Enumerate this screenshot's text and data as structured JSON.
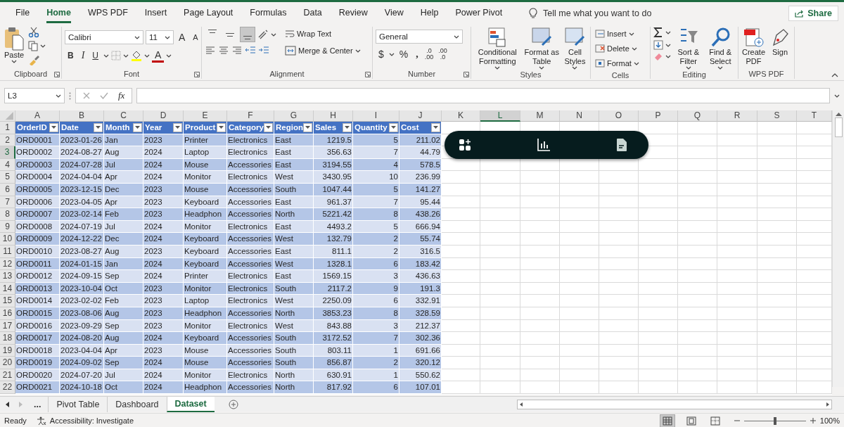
{
  "menu_tabs": [
    {
      "label": "File",
      "selected": false
    },
    {
      "label": "Home",
      "selected": true
    },
    {
      "label": "WPS PDF",
      "selected": false
    },
    {
      "label": "Insert",
      "selected": false
    },
    {
      "label": "Page Layout",
      "selected": false
    },
    {
      "label": "Formulas",
      "selected": false
    },
    {
      "label": "Data",
      "selected": false
    },
    {
      "label": "Review",
      "selected": false
    },
    {
      "label": "View",
      "selected": false
    },
    {
      "label": "Help",
      "selected": false
    },
    {
      "label": "Power Pivot",
      "selected": false
    }
  ],
  "tell_me": {
    "placeholder": "Tell me what you want to do"
  },
  "share_button": "Share",
  "ribbon": {
    "clipboard": {
      "paste": "Paste",
      "label": "Clipboard"
    },
    "font": {
      "font_name": "Calibri",
      "font_size": "11",
      "grow": "A",
      "shrink": "A",
      "bold": "B",
      "italic": "I",
      "underline": "U",
      "font_color": "A",
      "label": "Font"
    },
    "alignment": {
      "vertical_buttons": [
        {
          "selected": false
        },
        {
          "selected": false
        },
        {
          "selected": true
        }
      ],
      "wrap_text": "Wrap Text",
      "merge_center": "Merge & Center",
      "label": "Alignment"
    },
    "number": {
      "format": "General",
      "currency": "$",
      "percent": "%",
      "comma": ",",
      "increase_decimal": [
        ".0",
        ".00"
      ],
      "decrease_decimal": [
        ".00",
        ".0"
      ],
      "label": "Number"
    },
    "styles": {
      "buttons": [
        "Conditional Formatting",
        "Format as Table",
        "Cell Styles"
      ],
      "label": "Styles"
    },
    "cells": {
      "buttons": [
        "Insert",
        "Delete",
        "Format"
      ],
      "label": "Cells"
    },
    "editing": {
      "buttons": [
        "Sort & Filter",
        "Find & Select"
      ],
      "label": "Editing"
    },
    "wps_pdf": {
      "buttons": [
        "Create PDF",
        "Sign"
      ],
      "label": "WPS PDF"
    }
  },
  "formula_bar": {
    "name_box": "L3",
    "function_label": "fx"
  },
  "sheet": {
    "columns": [
      {
        "label": "A",
        "selected": false
      },
      {
        "label": "B",
        "selected": false
      },
      {
        "label": "C",
        "selected": false
      },
      {
        "label": "D",
        "selected": false
      },
      {
        "label": "E",
        "selected": false
      },
      {
        "label": "F",
        "selected": false
      },
      {
        "label": "G",
        "selected": false
      },
      {
        "label": "H",
        "selected": false
      },
      {
        "label": "I",
        "selected": false
      },
      {
        "label": "J",
        "selected": false
      },
      {
        "label": "K",
        "selected": false
      },
      {
        "label": "L",
        "selected": true
      },
      {
        "label": "M",
        "selected": false
      },
      {
        "label": "N",
        "selected": false
      },
      {
        "label": "O",
        "selected": false
      },
      {
        "label": "P",
        "selected": false
      },
      {
        "label": "Q",
        "selected": false
      },
      {
        "label": "R",
        "selected": false
      },
      {
        "label": "S",
        "selected": false
      },
      {
        "label": "T",
        "selected": false
      }
    ],
    "rows": [
      {
        "label": "1",
        "selected": false
      },
      {
        "label": "2",
        "selected": false
      },
      {
        "label": "3",
        "selected": true
      },
      {
        "label": "4",
        "selected": false
      },
      {
        "label": "5",
        "selected": false
      },
      {
        "label": "6",
        "selected": false
      },
      {
        "label": "7",
        "selected": false
      },
      {
        "label": "8",
        "selected": false
      },
      {
        "label": "9",
        "selected": false
      },
      {
        "label": "10",
        "selected": false
      },
      {
        "label": "11",
        "selected": false
      },
      {
        "label": "12",
        "selected": false
      },
      {
        "label": "13",
        "selected": false
      },
      {
        "label": "14",
        "selected": false
      },
      {
        "label": "15",
        "selected": false
      },
      {
        "label": "16",
        "selected": false
      },
      {
        "label": "17",
        "selected": false
      },
      {
        "label": "18",
        "selected": false
      },
      {
        "label": "19",
        "selected": false
      },
      {
        "label": "20",
        "selected": false
      },
      {
        "label": "21",
        "selected": false
      },
      {
        "label": "22",
        "selected": false
      }
    ]
  },
  "table": {
    "columns": [
      {
        "label": "OrderID",
        "kind": "text"
      },
      {
        "label": "Date",
        "kind": "text"
      },
      {
        "label": "Month",
        "kind": "text"
      },
      {
        "label": "Year",
        "kind": "text"
      },
      {
        "label": "Product",
        "kind": "text"
      },
      {
        "label": "Category",
        "kind": "text"
      },
      {
        "label": "Region",
        "kind": "text"
      },
      {
        "label": "Sales",
        "kind": "number"
      },
      {
        "label": "Quantity",
        "kind": "number"
      },
      {
        "label": "Cost",
        "kind": "number"
      }
    ],
    "rows": [
      [
        "ORD0001",
        "2023-01-26",
        "Jan",
        "2023",
        "Printer",
        "Electronics",
        "East",
        "1219.5",
        "5",
        "211.02"
      ],
      [
        "ORD0002",
        "2024-08-27",
        "Aug",
        "2024",
        "Laptop",
        "Electronics",
        "East",
        "356.63",
        "7",
        "44.79"
      ],
      [
        "ORD0003",
        "2024-07-28",
        "Jul",
        "2024",
        "Mouse",
        "Accessories",
        "East",
        "3194.55",
        "4",
        "578.5"
      ],
      [
        "ORD0004",
        "2024-04-04",
        "Apr",
        "2024",
        "Monitor",
        "Electronics",
        "West",
        "3430.95",
        "10",
        "236.99"
      ],
      [
        "ORD0005",
        "2023-12-15",
        "Dec",
        "2023",
        "Mouse",
        "Accessories",
        "South",
        "1047.44",
        "5",
        "141.27"
      ],
      [
        "ORD0006",
        "2023-04-05",
        "Apr",
        "2023",
        "Keyboard",
        "Accessories",
        "East",
        "961.37",
        "7",
        "95.44"
      ],
      [
        "ORD0007",
        "2023-02-14",
        "Feb",
        "2023",
        "Headphon",
        "Accessories",
        "North",
        "5221.42",
        "8",
        "438.26"
      ],
      [
        "ORD0008",
        "2024-07-19",
        "Jul",
        "2024",
        "Monitor",
        "Electronics",
        "East",
        "4493.2",
        "5",
        "666.94"
      ],
      [
        "ORD0009",
        "2024-12-22",
        "Dec",
        "2024",
        "Keyboard",
        "Accessories",
        "West",
        "132.79",
        "2",
        "55.74"
      ],
      [
        "ORD0010",
        "2023-08-27",
        "Aug",
        "2023",
        "Keyboard",
        "Accessories",
        "East",
        "811.1",
        "2",
        "316.5"
      ],
      [
        "ORD0011",
        "2024-01-15",
        "Jan",
        "2024",
        "Keyboard",
        "Accessories",
        "West",
        "1328.1",
        "6",
        "183.42"
      ],
      [
        "ORD0012",
        "2024-09-15",
        "Sep",
        "2024",
        "Printer",
        "Electronics",
        "East",
        "1569.15",
        "3",
        "436.63"
      ],
      [
        "ORD0013",
        "2023-10-04",
        "Oct",
        "2023",
        "Monitor",
        "Electronics",
        "South",
        "2117.2",
        "9",
        "191.3"
      ],
      [
        "ORD0014",
        "2023-02-02",
        "Feb",
        "2023",
        "Laptop",
        "Electronics",
        "West",
        "2250.09",
        "6",
        "332.91"
      ],
      [
        "ORD0015",
        "2023-08-06",
        "Aug",
        "2023",
        "Headphon",
        "Accessories",
        "North",
        "3853.23",
        "8",
        "328.59"
      ],
      [
        "ORD0016",
        "2023-09-29",
        "Sep",
        "2023",
        "Monitor",
        "Electronics",
        "West",
        "843.88",
        "3",
        "212.37"
      ],
      [
        "ORD0017",
        "2024-08-20",
        "Aug",
        "2024",
        "Keyboard",
        "Accessories",
        "South",
        "3172.52",
        "7",
        "302.36"
      ],
      [
        "ORD0018",
        "2023-04-04",
        "Apr",
        "2023",
        "Mouse",
        "Accessories",
        "South",
        "803.11",
        "1",
        "691.66"
      ],
      [
        "ORD0019",
        "2024-09-02",
        "Sep",
        "2024",
        "Mouse",
        "Accessories",
        "South",
        "856.87",
        "2",
        "320.12"
      ],
      [
        "ORD0020",
        "2024-07-20",
        "Jul",
        "2024",
        "Monitor",
        "Electronics",
        "North",
        "630.91",
        "1",
        "550.62"
      ],
      [
        "ORD0021",
        "2024-10-18",
        "Oct",
        "2024",
        "Headphon",
        "Accessories",
        "North",
        "817.92",
        "6",
        "107.01"
      ]
    ]
  },
  "sheet_tabs": {
    "more": "...",
    "tabs": [
      {
        "label": "Pivot Table",
        "selected": false
      },
      {
        "label": "Dashboard",
        "selected": false
      },
      {
        "label": "Dataset",
        "selected": true
      }
    ]
  },
  "status_bar": {
    "ready": "Ready",
    "accessibility": "Accessibility: Investigate",
    "views": [
      {
        "selected": true
      },
      {
        "selected": false
      },
      {
        "selected": false
      }
    ],
    "zoom": {
      "level": 0.5,
      "reading": "100%"
    }
  }
}
